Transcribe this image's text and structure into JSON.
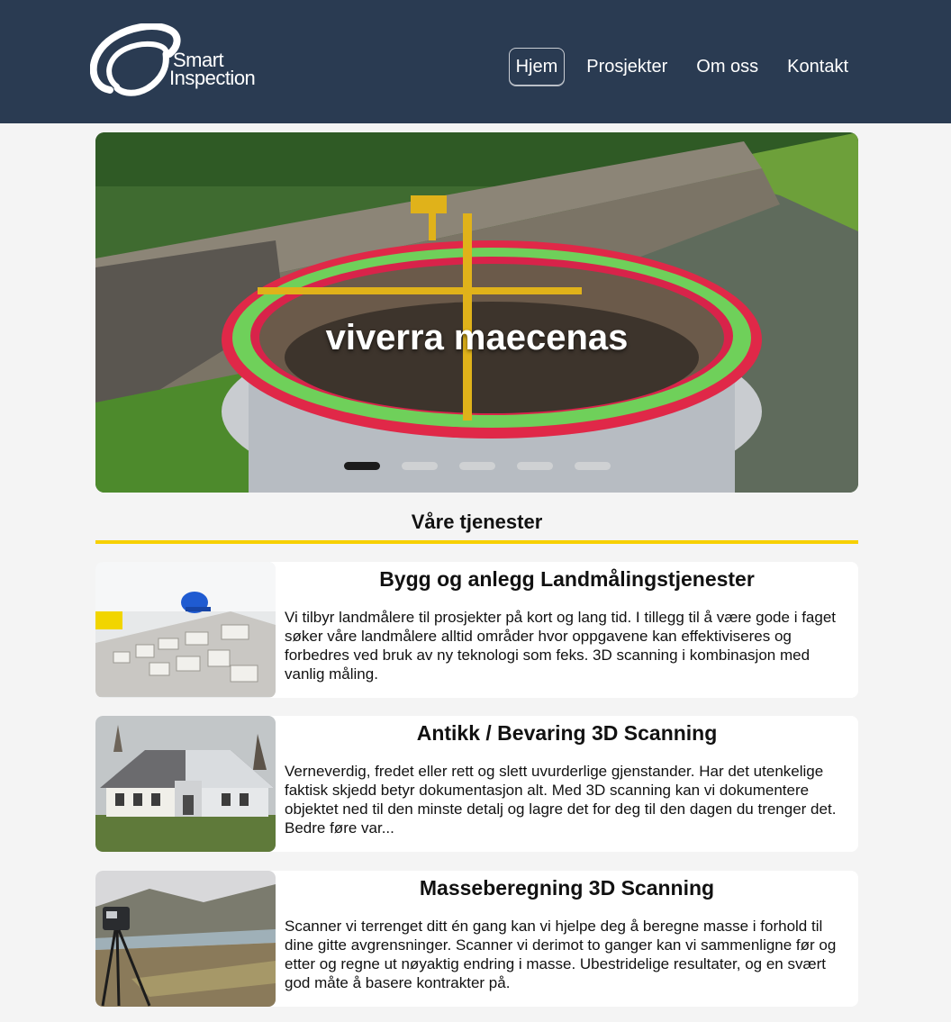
{
  "brand": {
    "line1": "Smart",
    "line2": "Inspection"
  },
  "nav": [
    {
      "label": "Hjem",
      "active": true
    },
    {
      "label": "Prosjekter",
      "active": false
    },
    {
      "label": "Om oss",
      "active": false
    },
    {
      "label": "Kontakt",
      "active": false
    }
  ],
  "hero": {
    "caption": "viverra maecenas",
    "slides": 5,
    "active_slide": 1
  },
  "services": {
    "title": "Våre tjenester",
    "items": [
      {
        "title": "Bygg og anlegg Landmålingstjenester",
        "text": "Vi tilbyr landmålere til prosjekter på kort og lang tid. I tillegg til å være gode i faget søker våre landmålere alltid områder hvor oppgavene kan effektiviseres og forbedres ved bruk av ny teknologi som feks. 3D scanning i kombinasjon med vanlig måling."
      },
      {
        "title": "Antikk / Bevaring 3D Scanning",
        "text": "Verneverdig, fredet eller rett og slett uvurderlige gjenstander. Har det utenkelige faktisk skjedd betyr dokumentasjon alt. Med 3D scanning kan vi dokumentere objektet ned til den minste detalj og lagre det for deg til den dagen du trenger det. Bedre føre var..."
      },
      {
        "title": "Masseberegning 3D Scanning",
        "text": "Scanner vi terrenget ditt én gang kan vi hjelpe deg å beregne masse i forhold til dine gitte avgrensninger. Scanner vi derimot to ganger kan vi sammenligne før og etter og regne ut nøyaktig endring i masse. Ubestridelige resultater, og en svært god måte å basere kontrakter på."
      }
    ]
  },
  "colors": {
    "header": "#2a3b52",
    "accent": "#f7d000",
    "page": "#f4f4f4"
  }
}
